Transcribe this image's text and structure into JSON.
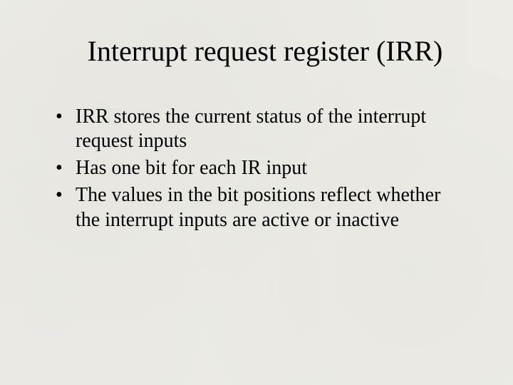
{
  "slide": {
    "title": "Interrupt request register (IRR)",
    "bullets": [
      "IRR stores the current status of the interrupt request inputs",
      "Has one bit for each IR input",
      "The values in the bit positions reflect whether the interrupt inputs are active or inactive"
    ]
  }
}
